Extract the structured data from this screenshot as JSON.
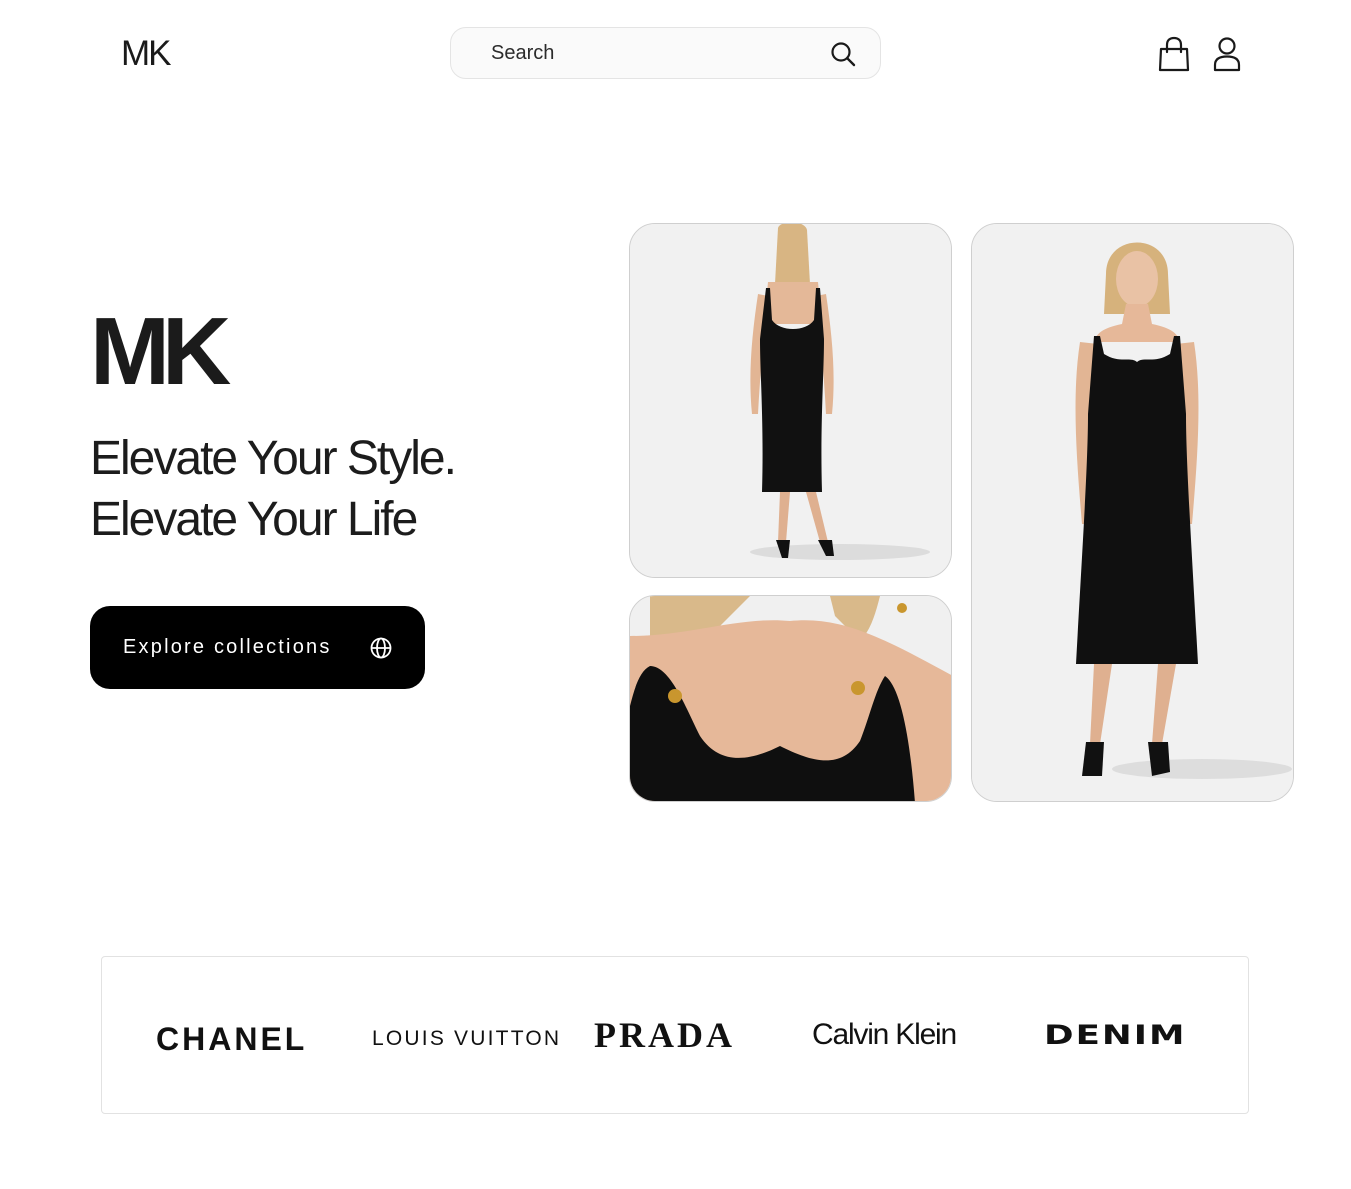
{
  "header": {
    "logo": "MK",
    "search": {
      "placeholder": "Search",
      "value": ""
    },
    "icons": [
      "search-icon",
      "shopping-bag-icon",
      "user-icon"
    ]
  },
  "hero": {
    "brand": "MK",
    "tagline_line1": "Elevate Your Style.",
    "tagline_line2": "Elevate Your Life",
    "cta_label": "Explore collections",
    "cta_icon": "globe-icon"
  },
  "gallery": {
    "images": [
      "model-back-view-black-midi-dress",
      "model-neckline-detail-black-dress",
      "model-front-view-black-midi-dress"
    ]
  },
  "brands": {
    "items": [
      "CHANEL",
      "LOUIS VUITTON",
      "PRADA",
      "Calvin Klein",
      "DENIM"
    ]
  },
  "colors": {
    "background": "#ffffff",
    "text": "#161616",
    "button": "#000000",
    "button_text": "#ffffff",
    "photo_bg": "#f1f1f1",
    "border": "#e2e2e2"
  }
}
